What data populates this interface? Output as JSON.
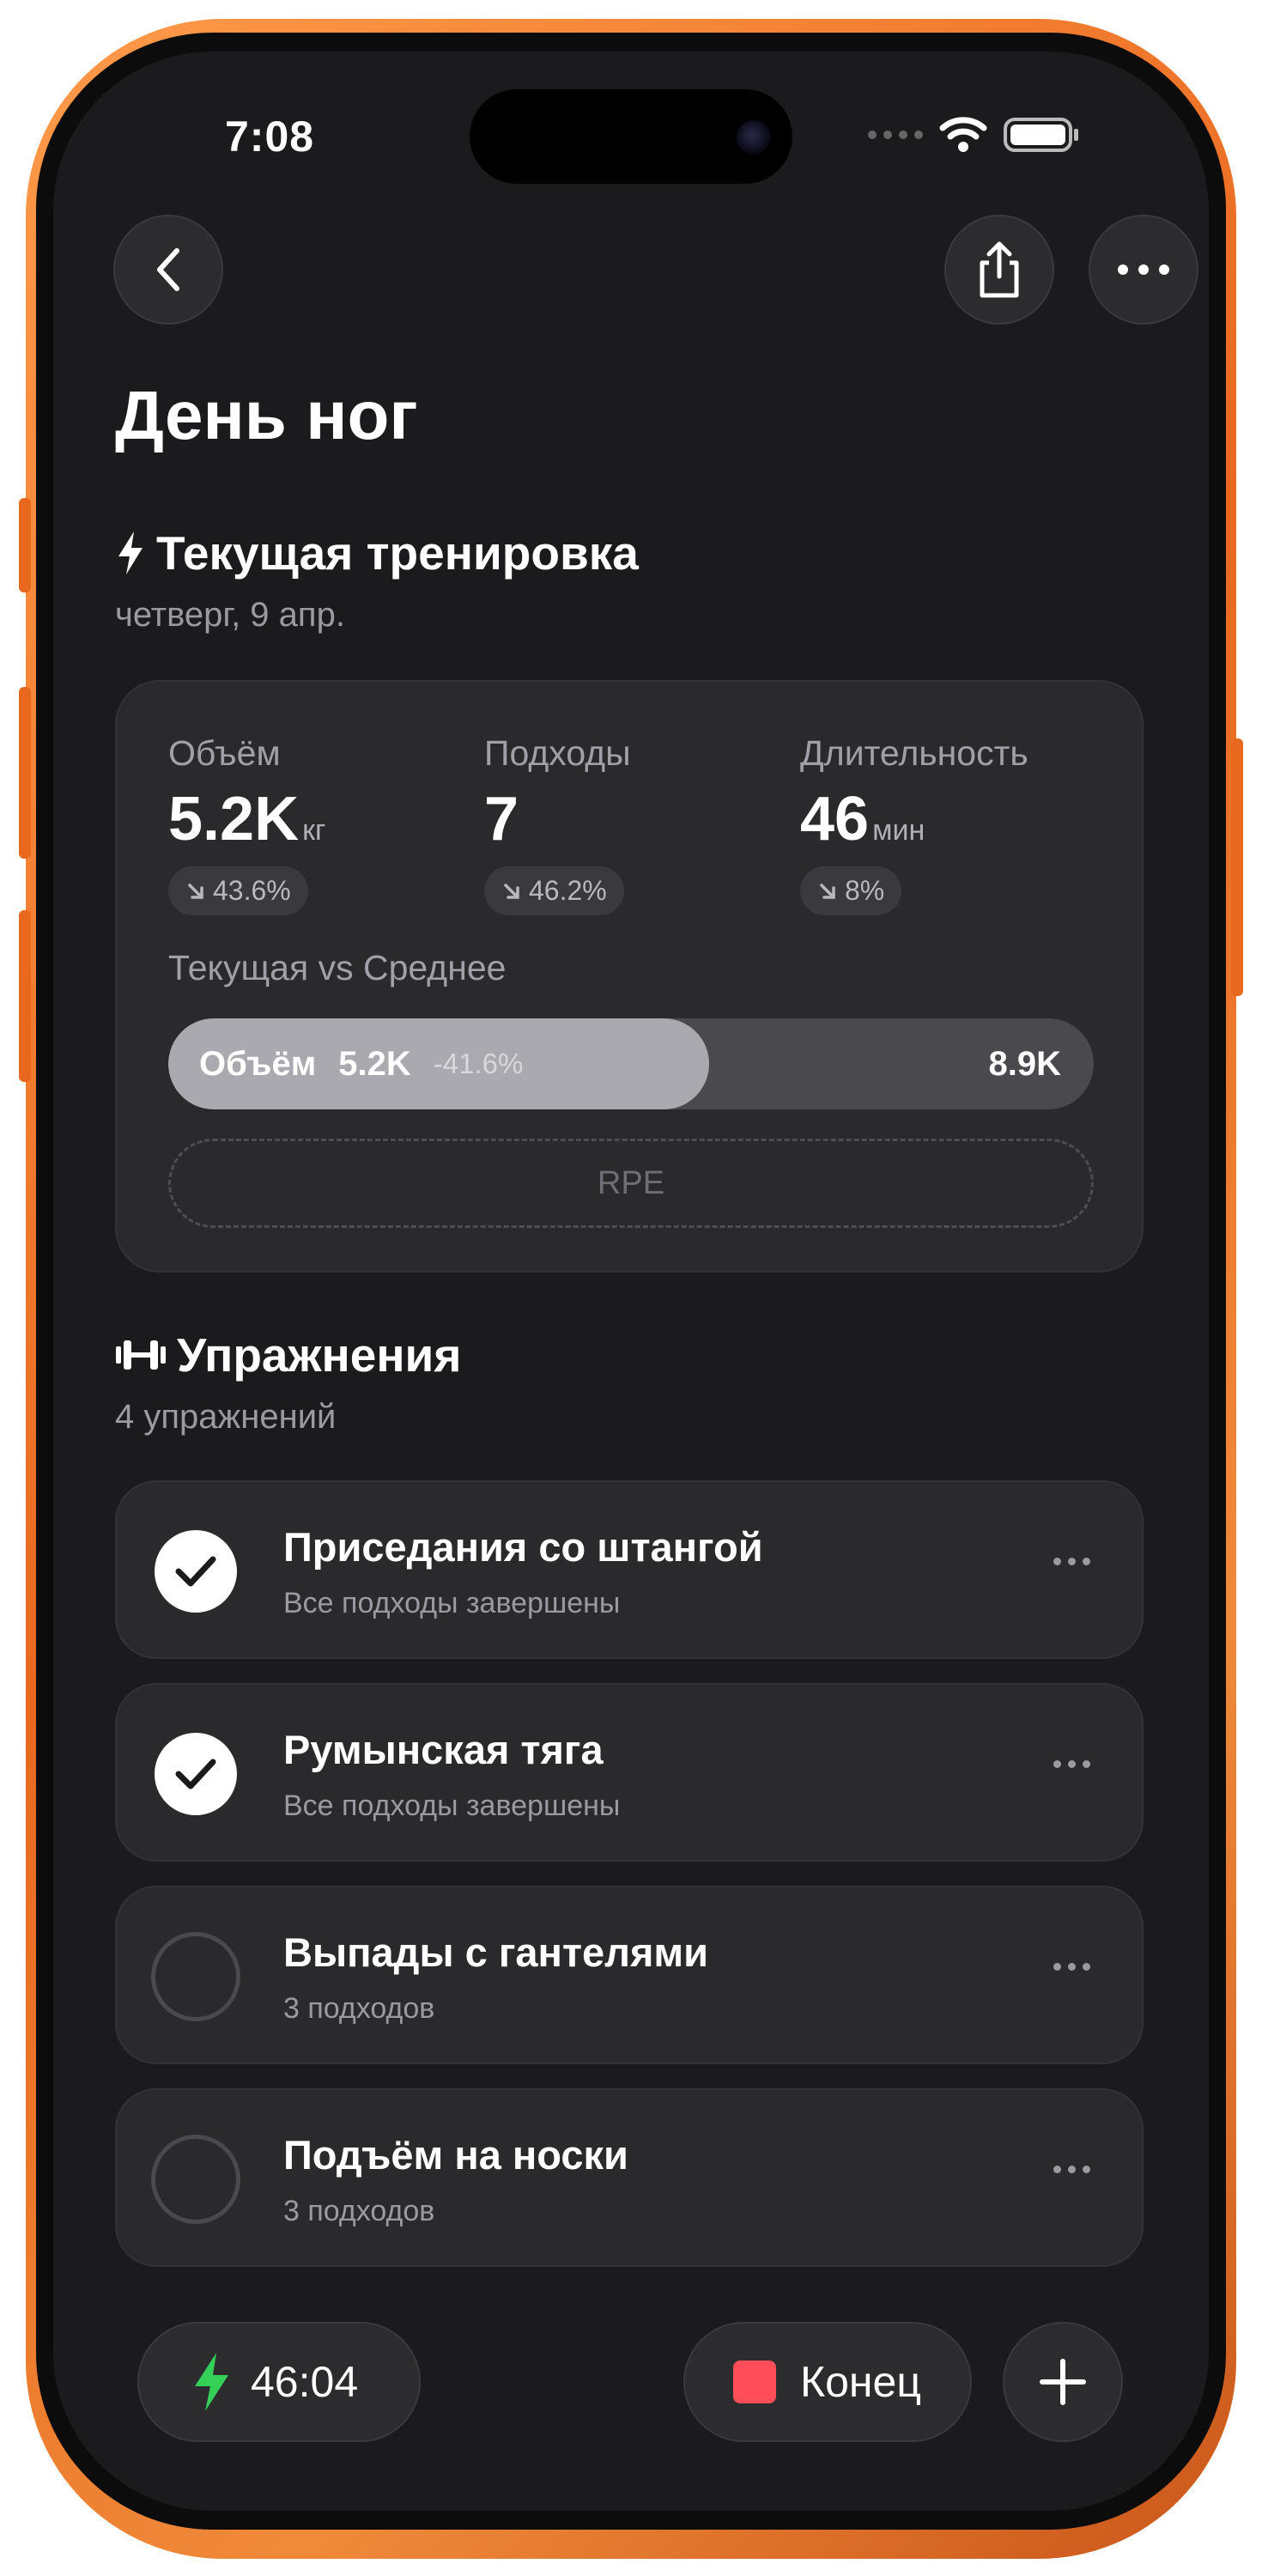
{
  "status_bar": {
    "time": "7:08"
  },
  "header": {
    "title": "День ног"
  },
  "current_workout": {
    "title": "Текущая тренировка",
    "date": "четверг, 9 апр.",
    "metrics": [
      {
        "label": "Объём",
        "value": "5.2K",
        "unit": "кг",
        "change": "43.6%"
      },
      {
        "label": "Подходы",
        "value": "7",
        "unit": "",
        "change": "46.2%"
      },
      {
        "label": "Длительность",
        "value": "46",
        "unit": "мин",
        "change": "8%"
      }
    ],
    "compare": {
      "label": "Текущая vs Среднее",
      "metric": "Объём",
      "current": "5.2K",
      "delta": "-41.6%",
      "average": "8.9K",
      "fill_fraction": 0.584
    },
    "rpe_label": "RPE"
  },
  "exercises": {
    "title": "Упражнения",
    "count_label": "4 упражнений",
    "items": [
      {
        "name": "Приседания со штангой",
        "status": "Все подходы завершены",
        "done": true
      },
      {
        "name": "Румынская тяга",
        "status": "Все подходы завершены",
        "done": true
      },
      {
        "name": "Выпады с гантелями",
        "status": "3 подходов",
        "done": false
      },
      {
        "name": "Подъём на носки",
        "status": "3 подходов",
        "done": false
      }
    ]
  },
  "bottom_bar": {
    "timer": "46:04",
    "end_label": "Конец"
  },
  "colors": {
    "accent_green": "#34d058",
    "stop_red": "#ff4d5a",
    "frame_orange": "#e8681e"
  }
}
